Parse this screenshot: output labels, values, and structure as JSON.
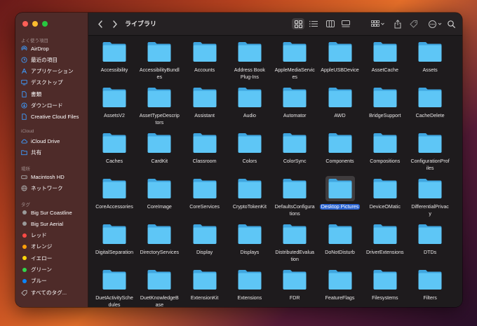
{
  "window": {
    "title": "ライブラリ"
  },
  "sidebar": {
    "favorites_label": "よく使う項目",
    "favorites": [
      {
        "label": "AirDrop",
        "icon": "airdrop-icon"
      },
      {
        "label": "最近の項目",
        "icon": "clock-icon"
      },
      {
        "label": "アプリケーション",
        "icon": "applications-icon"
      },
      {
        "label": "デスクトップ",
        "icon": "desktop-icon"
      },
      {
        "label": "書類",
        "icon": "document-icon"
      },
      {
        "label": "ダウンロード",
        "icon": "download-icon"
      },
      {
        "label": "Creative Cloud Files",
        "icon": "file-icon"
      }
    ],
    "icloud_label": "iCloud",
    "icloud": [
      {
        "label": "iCloud Drive",
        "icon": "cloud-icon"
      },
      {
        "label": "共有",
        "icon": "shared-folder-icon"
      }
    ],
    "locations_label": "場所",
    "locations": [
      {
        "label": "Macintosh HD",
        "icon": "disk-icon"
      },
      {
        "label": "ネットワーク",
        "icon": "network-icon"
      }
    ],
    "tags_label": "タグ",
    "tags": [
      {
        "label": "Big Sur Coastline",
        "color": "#9a9a9a"
      },
      {
        "label": "Big Sur Aerial",
        "color": "#9a9a9a"
      },
      {
        "label": "レッド",
        "color": "#ff4a45"
      },
      {
        "label": "オレンジ",
        "color": "#ff9f0a"
      },
      {
        "label": "イエロー",
        "color": "#ffd60a"
      },
      {
        "label": "グリーン",
        "color": "#32d74b"
      },
      {
        "label": "ブルー",
        "color": "#0a84ff"
      },
      {
        "label": "すべてのタグ...",
        "color": "hollow"
      }
    ]
  },
  "folders": [
    [
      "Accessibility"
    ],
    [
      "AccessibilityBundles"
    ],
    [
      "Accounts"
    ],
    [
      "Address Book Plug-Ins"
    ],
    [
      "AppleMediaServices"
    ],
    [
      "AppleUSBDevice"
    ],
    [
      "AssetCache"
    ],
    [
      "Assets"
    ],
    [
      "AssetsV2"
    ],
    [
      "AssetTypeDescriptors"
    ],
    [
      "Assistant"
    ],
    [
      "Audio"
    ],
    [
      "Automator"
    ],
    [
      "AWD"
    ],
    [
      "BridgeSupport"
    ],
    [
      "CacheDelete"
    ],
    [
      "Caches"
    ],
    [
      "CardKit"
    ],
    [
      "Classroom"
    ],
    [
      "Colors"
    ],
    [
      "ColorSync"
    ],
    [
      "Components"
    ],
    [
      "Compositions"
    ],
    [
      "ConfigurationProfiles"
    ],
    [
      "CoreAccessories"
    ],
    [
      "CoreImage"
    ],
    [
      "CoreServices"
    ],
    [
      "CryptoTokenKit"
    ],
    [
      "DefaultsConfigurations"
    ],
    [
      "Desktop Pictures"
    ],
    [
      "DeviceOMatic"
    ],
    [
      "DifferentialPrivacy"
    ],
    [
      "DigitalSeparation"
    ],
    [
      "DirectoryServices"
    ],
    [
      "Display"
    ],
    [
      "Displays"
    ],
    [
      "DistributedEvaluation"
    ],
    [
      "DoNotDisturb"
    ],
    [
      "DriverExtensions"
    ],
    [
      "DTDs"
    ],
    [
      "DuetActivitySchedule"
    ],
    [
      "DuetKnowledgeBase"
    ],
    [
      "ExtensionKit"
    ],
    [
      "Extensions"
    ],
    [
      "FDR"
    ],
    [
      "FeatureFlags"
    ],
    [
      "Filesystems"
    ],
    [
      "Filters"
    ]
  ],
  "folder_display": [
    [
      "Accessibility"
    ],
    [
      "AccessibilityBundl",
      "es"
    ],
    [
      "Accounts"
    ],
    [
      "Address Book",
      "Plug-Ins"
    ],
    [
      "AppleMediaServic",
      "es"
    ],
    [
      "AppleUSBDevice"
    ],
    [
      "AssetCache"
    ],
    [
      "Assets"
    ],
    [
      "AssetsV2"
    ],
    [
      "AssetTypeDescrip",
      "tors"
    ],
    [
      "Assistant"
    ],
    [
      "Audio"
    ],
    [
      "Automator"
    ],
    [
      "AWD"
    ],
    [
      "BridgeSupport"
    ],
    [
      "CacheDelete"
    ],
    [
      "Caches"
    ],
    [
      "CardKit"
    ],
    [
      "Classroom"
    ],
    [
      "Colors"
    ],
    [
      "ColorSync"
    ],
    [
      "Components"
    ],
    [
      "Compositions"
    ],
    [
      "ConfigurationProf",
      "iles"
    ],
    [
      "CoreAccessories"
    ],
    [
      "CoreImage"
    ],
    [
      "CoreServices"
    ],
    [
      "CryptoTokenKit"
    ],
    [
      "DefaultsConfigura",
      "tions"
    ],
    [
      "Desktop Pictures"
    ],
    [
      "DeviceOMatic"
    ],
    [
      "DifferentialPrivac",
      "y"
    ],
    [
      "DigitalSeparation"
    ],
    [
      "DirectoryServices"
    ],
    [
      "Display"
    ],
    [
      "Displays"
    ],
    [
      "DistributedEvalua",
      "tion"
    ],
    [
      "DoNotDisturb"
    ],
    [
      "DriverExtensions"
    ],
    [
      "DTDs"
    ],
    [
      "DuetActivitySche",
      "dules"
    ],
    [
      "DuetKnowledgeB",
      "ase"
    ],
    [
      "ExtensionKit"
    ],
    [
      "Extensions"
    ],
    [
      "FDR"
    ],
    [
      "FeatureFlags"
    ],
    [
      "Filesystems"
    ],
    [
      "Filters"
    ]
  ],
  "selected_folder": "Desktop Pictures",
  "colors": {
    "folder_front": "#5ec6f6",
    "folder_back": "#3fa6e0",
    "selection": "#2a63d2"
  }
}
